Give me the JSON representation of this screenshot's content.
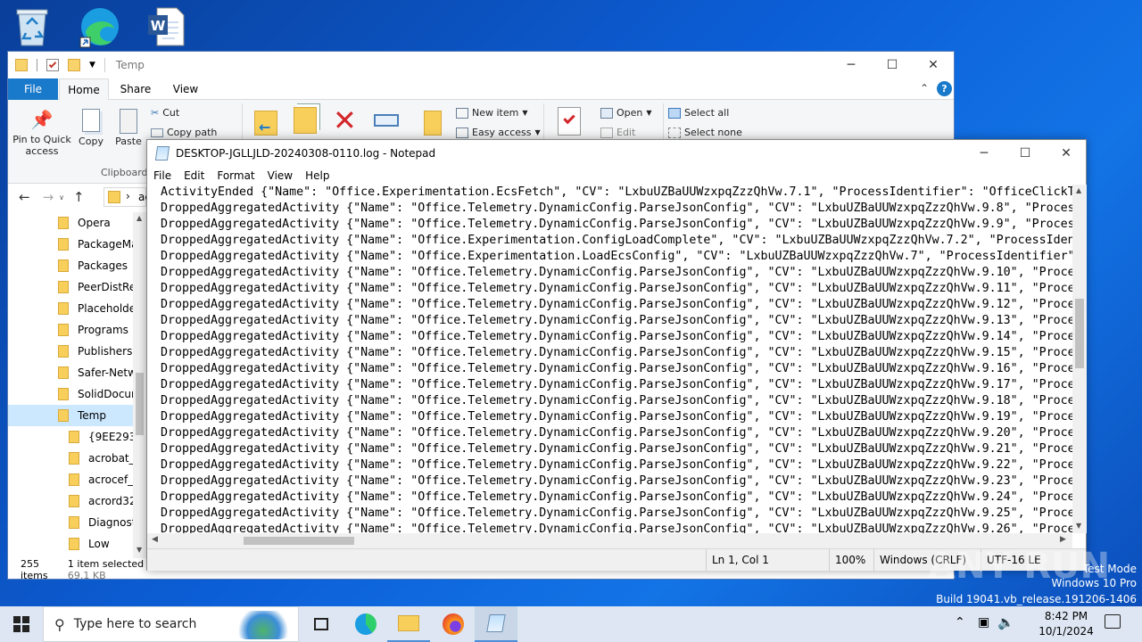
{
  "explorer": {
    "title": "Temp",
    "tabs": [
      "File",
      "Home",
      "Share",
      "View"
    ],
    "ribbon": {
      "pin": "Pin to Quick access",
      "copy": "Copy",
      "paste": "Paste",
      "cut": "Cut",
      "copy_path": "Copy path",
      "clipboard": "Clipboard",
      "new_item": "New item",
      "easy_access": "Easy access",
      "open": "Open",
      "edit": "Edit",
      "select_all": "Select all",
      "select_none": "Select none"
    },
    "address_fragment": "ac",
    "nav_items": [
      "Opera",
      "PackageMa",
      "Packages",
      "PeerDistRep",
      "Placeholder",
      "Programs",
      "Publishers",
      "Safer-Netwo",
      "SolidDocum",
      "Temp",
      "{9EE293E3-",
      "acrobat_sb",
      "acrocef_lo",
      "acrord32_s",
      "Diagnostic",
      "Low"
    ],
    "selected_item": "Temp",
    "status_items": "255 items",
    "status_selected": "1 item selected",
    "status_size": "69.1 KB"
  },
  "notepad": {
    "title": "DESKTOP-JGLLJLD-20240308-0110.log - Notepad",
    "menu": [
      "File",
      "Edit",
      "Format",
      "View",
      "Help"
    ],
    "lines": [
      "ActivityEnded {\"Name\": \"Office.Experimentation.EcsFetch\", \"CV\": \"LxbuUZBaUUWzxpqZzzQhVw.7.1\", \"ProcessIdentifier\": \"OfficeClickT",
      "DroppedAggregatedActivity {\"Name\": \"Office.Telemetry.DynamicConfig.ParseJsonConfig\", \"CV\": \"LxbuUZBaUUWzxpqZzzQhVw.9.8\", \"Proces",
      "DroppedAggregatedActivity {\"Name\": \"Office.Telemetry.DynamicConfig.ParseJsonConfig\", \"CV\": \"LxbuUZBaUUWzxpqZzzQhVw.9.9\", \"Proces",
      "DroppedAggregatedActivity {\"Name\": \"Office.Experimentation.ConfigLoadComplete\", \"CV\": \"LxbuUZBaUUWzxpqZzzQhVw.7.2\", \"ProcessIden",
      "DroppedAggregatedActivity {\"Name\": \"Office.Experimentation.LoadEcsConfig\", \"CV\": \"LxbuUZBaUUWzxpqZzzQhVw.7\", \"ProcessIdentifier\"",
      "DroppedAggregatedActivity {\"Name\": \"Office.Telemetry.DynamicConfig.ParseJsonConfig\", \"CV\": \"LxbuUZBaUUWzxpqZzzQhVw.9.10\", \"Proce",
      "DroppedAggregatedActivity {\"Name\": \"Office.Telemetry.DynamicConfig.ParseJsonConfig\", \"CV\": \"LxbuUZBaUUWzxpqZzzQhVw.9.11\", \"Proce",
      "DroppedAggregatedActivity {\"Name\": \"Office.Telemetry.DynamicConfig.ParseJsonConfig\", \"CV\": \"LxbuUZBaUUWzxpqZzzQhVw.9.12\", \"Proce",
      "DroppedAggregatedActivity {\"Name\": \"Office.Telemetry.DynamicConfig.ParseJsonConfig\", \"CV\": \"LxbuUZBaUUWzxpqZzzQhVw.9.13\", \"Proce",
      "DroppedAggregatedActivity {\"Name\": \"Office.Telemetry.DynamicConfig.ParseJsonConfig\", \"CV\": \"LxbuUZBaUUWzxpqZzzQhVw.9.14\", \"Proce",
      "DroppedAggregatedActivity {\"Name\": \"Office.Telemetry.DynamicConfig.ParseJsonConfig\", \"CV\": \"LxbuUZBaUUWzxpqZzzQhVw.9.15\", \"Proce",
      "DroppedAggregatedActivity {\"Name\": \"Office.Telemetry.DynamicConfig.ParseJsonConfig\", \"CV\": \"LxbuUZBaUUWzxpqZzzQhVw.9.16\", \"Proce",
      "DroppedAggregatedActivity {\"Name\": \"Office.Telemetry.DynamicConfig.ParseJsonConfig\", \"CV\": \"LxbuUZBaUUWzxpqZzzQhVw.9.17\", \"Proce",
      "DroppedAggregatedActivity {\"Name\": \"Office.Telemetry.DynamicConfig.ParseJsonConfig\", \"CV\": \"LxbuUZBaUUWzxpqZzzQhVw.9.18\", \"Proce",
      "DroppedAggregatedActivity {\"Name\": \"Office.Telemetry.DynamicConfig.ParseJsonConfig\", \"CV\": \"LxbuUZBaUUWzxpqZzzQhVw.9.19\", \"Proce",
      "DroppedAggregatedActivity {\"Name\": \"Office.Telemetry.DynamicConfig.ParseJsonConfig\", \"CV\": \"LxbuUZBaUUWzxpqZzzQhVw.9.20\", \"Proce",
      "DroppedAggregatedActivity {\"Name\": \"Office.Telemetry.DynamicConfig.ParseJsonConfig\", \"CV\": \"LxbuUZBaUUWzxpqZzzQhVw.9.21\", \"Proce",
      "DroppedAggregatedActivity {\"Name\": \"Office.Telemetry.DynamicConfig.ParseJsonConfig\", \"CV\": \"LxbuUZBaUUWzxpqZzzQhVw.9.22\", \"Proce",
      "DroppedAggregatedActivity {\"Name\": \"Office.Telemetry.DynamicConfig.ParseJsonConfig\", \"CV\": \"LxbuUZBaUUWzxpqZzzQhVw.9.23\", \"Proce",
      "DroppedAggregatedActivity {\"Name\": \"Office.Telemetry.DynamicConfig.ParseJsonConfig\", \"CV\": \"LxbuUZBaUUWzxpqZzzQhVw.9.24\", \"Proce",
      "DroppedAggregatedActivity {\"Name\": \"Office.Telemetry.DynamicConfig.ParseJsonConfig\", \"CV\": \"LxbuUZBaUUWzxpqZzzQhVw.9.25\", \"Proce",
      "DroppedAggregatedActivity {\"Name\": \"Office.Telemetry.DynamicConfig.ParseJsonConfig\", \"CV\": \"LxbuUZBaUUWzxpqZzzQhVw.9.26\", \"Proce"
    ],
    "status": {
      "position": "Ln 1, Col 1",
      "zoom": "100%",
      "line_ending": "Windows (CRLF)",
      "encoding": "UTF-16 LE"
    }
  },
  "watermark": {
    "line1": "Test Mode",
    "line2": "Windows 10 Pro",
    "line3": "Build 19041.vb_release.191206-1406",
    "brand": "ANY RUN"
  },
  "taskbar": {
    "search_placeholder": "Type here to search",
    "time": "8:42 PM",
    "date": "10/1/2024"
  }
}
